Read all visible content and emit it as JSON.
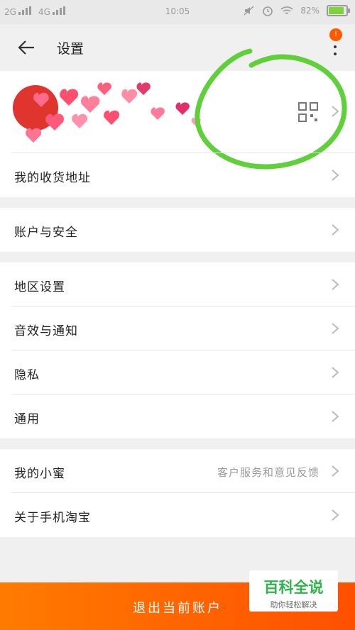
{
  "status_bar": {
    "network1": "2G",
    "network2": "4G",
    "time": "10:05",
    "battery": "82%"
  },
  "header": {
    "title": "设置",
    "badge": "!"
  },
  "profile": {
    "qr_icon": "qr-code-icon"
  },
  "rows": {
    "address": "我的收货地址",
    "account": "账户与安全",
    "region": "地区设置",
    "sound": "音效与通知",
    "privacy": "隐私",
    "general": "通用",
    "assistant": "我的小蜜",
    "assistant_sub": "客户服务和意见反馈",
    "about": "关于手机淘宝"
  },
  "logout_label": "退出当前账户",
  "watermark": {
    "line1": "百科全说",
    "line2": "助你轻松解决"
  },
  "colors": {
    "accent": "#ff5a00",
    "circle": "#5fcf3a",
    "battery": "#7cd43a"
  }
}
